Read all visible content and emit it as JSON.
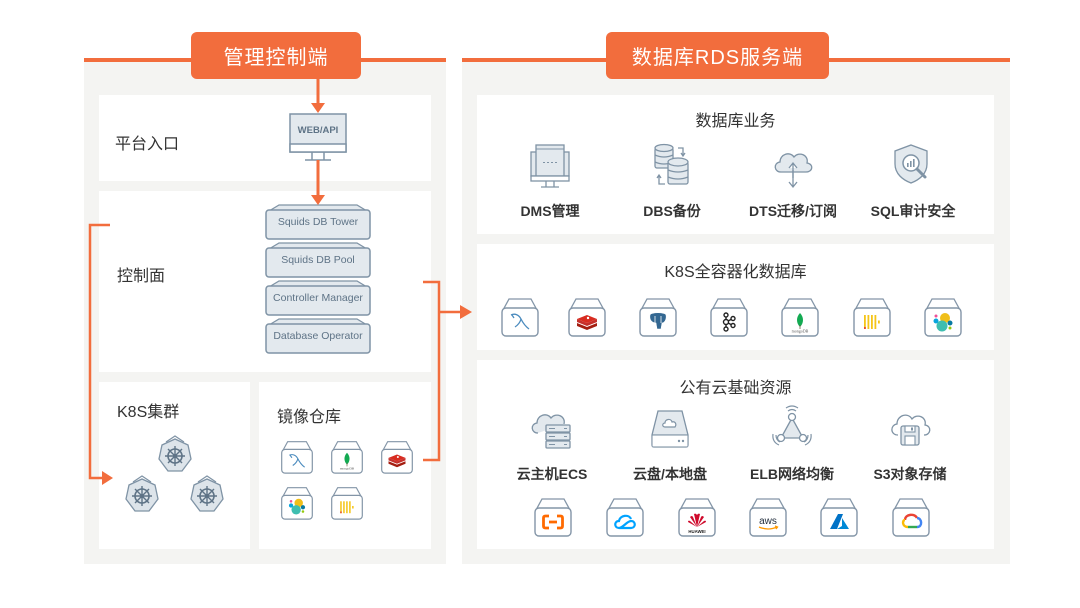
{
  "colors": {
    "accent": "#F26D3D",
    "panel_bg": "#F4F4F2",
    "card_bg": "#FFFFFF",
    "icon_stroke": "#7F93A5",
    "icon_fill": "#E3E9EE",
    "text": "#333333"
  },
  "management": {
    "title": "管理控制端",
    "platform_entry": {
      "label": "平台入口",
      "monitor_text": "WEB/API",
      "icon": "monitor-icon"
    },
    "control_plane": {
      "label": "控制面",
      "stack": [
        "Squids DB Tower",
        "Squids DB Pool",
        "Controller Manager",
        "Database Operator"
      ]
    },
    "k8s_cluster": {
      "label": "K8S集群",
      "nodes": [
        {
          "icon": "kubernetes-icon"
        },
        {
          "icon": "kubernetes-icon"
        },
        {
          "icon": "kubernetes-icon"
        }
      ]
    },
    "image_registry": {
      "label": "镜像仓库",
      "images": [
        {
          "name": "MySQL",
          "icon": "mysql-icon"
        },
        {
          "name": "MongoDB",
          "icon": "mongodb-icon",
          "logo_text": "mongoDB"
        },
        {
          "name": "Redis",
          "icon": "redis-icon"
        },
        {
          "name": "Elasticsearch",
          "icon": "elasticsearch-icon"
        },
        {
          "name": "ClickHouse",
          "icon": "clickhouse-icon"
        }
      ]
    }
  },
  "rds": {
    "title": "数据库RDS服务端",
    "business": {
      "title": "数据库业务",
      "items": [
        {
          "label": "DMS管理",
          "icon": "dms-monitor-icon"
        },
        {
          "label": "DBS备份",
          "icon": "database-backup-icon"
        },
        {
          "label": "DTS迁移/订阅",
          "icon": "cloud-transfer-icon"
        },
        {
          "label": "SQL审计安全",
          "icon": "shield-audit-icon"
        }
      ]
    },
    "k8s_databases": {
      "title": "K8S全容器化数据库",
      "items": [
        {
          "name": "MySQL",
          "icon": "mysql-icon"
        },
        {
          "name": "Redis",
          "icon": "redis-icon"
        },
        {
          "name": "PostgreSQL",
          "icon": "postgresql-icon"
        },
        {
          "name": "Kafka",
          "icon": "kafka-icon"
        },
        {
          "name": "MongoDB",
          "icon": "mongodb-icon",
          "logo_text": "mongoDB"
        },
        {
          "name": "ClickHouse",
          "icon": "clickhouse-icon"
        },
        {
          "name": "Elasticsearch",
          "icon": "elasticsearch-icon"
        }
      ]
    },
    "cloud_resources": {
      "title": "公有云基础资源",
      "items": [
        {
          "label": "云主机ECS",
          "icon": "cloud-server-icon"
        },
        {
          "label": "云盘/本地盘",
          "icon": "cloud-disk-icon"
        },
        {
          "label": "ELB网络均衡",
          "icon": "load-balancer-icon"
        },
        {
          "label": "S3对象存储",
          "icon": "object-storage-icon"
        }
      ],
      "providers": [
        {
          "name": "Alibaba Cloud",
          "icon": "aliyun-icon"
        },
        {
          "name": "Tencent Cloud",
          "icon": "tencent-cloud-icon"
        },
        {
          "name": "Huawei Cloud",
          "icon": "huawei-icon",
          "logo_text": "HUAWEI"
        },
        {
          "name": "AWS",
          "icon": "aws-icon",
          "logo_text": "aws"
        },
        {
          "name": "Azure",
          "icon": "azure-icon"
        },
        {
          "name": "Google Cloud",
          "icon": "gcp-icon"
        }
      ]
    }
  }
}
